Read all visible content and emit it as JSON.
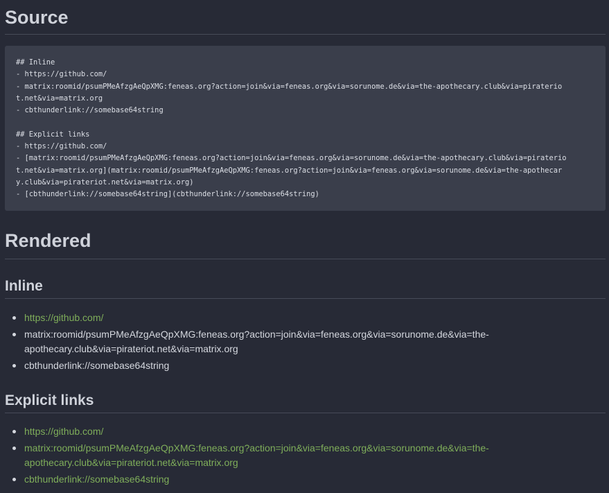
{
  "source_heading": "Source",
  "source_code": "## Inline\n- https://github.com/\n- matrix:roomid/psumPMeAfzgAeQpXMG:feneas.org?action=join&via=feneas.org&via=sorunome.de&via=the-apothecary.club&via=piraterio\nt.net&via=matrix.org\n- cbthunderlink://somebase64string\n\n## Explicit links\n- https://github.com/\n- [matrix:roomid/psumPMeAfzgAeQpXMG:feneas.org?action=join&via=feneas.org&via=sorunome.de&via=the-apothecary.club&via=piraterio\nt.net&via=matrix.org](matrix:roomid/psumPMeAfzgAeQpXMG:feneas.org?action=join&via=feneas.org&via=sorunome.de&via=the-apothecar\ny.club&via=pirateriot.net&via=matrix.org)\n- [cbthunderlink://somebase64string](cbthunderlink://somebase64string)",
  "rendered_heading": "Rendered",
  "inline": {
    "heading": "Inline",
    "items": [
      "https://github.com/",
      "matrix:roomid/psumPMeAfzgAeQpXMG:feneas.org?action=join&via=feneas.org&via=sorunome.de&via=the-apothecary.club&via=pirateriot.net&via=matrix.org",
      "cbthunderlink://somebase64string"
    ]
  },
  "explicit": {
    "heading": "Explicit links",
    "items": [
      "https://github.com/",
      "matrix:roomid/psumPMeAfzgAeQpXMG:feneas.org?action=join&via=feneas.org&via=sorunome.de&via=the-apothecary.club&via=pirateriot.net&via=matrix.org",
      "cbthunderlink://somebase64string"
    ]
  },
  "colors": {
    "background": "#272a36",
    "code_background": "#3a3e4b",
    "link": "#7fae5a",
    "text": "#d4d7de"
  }
}
